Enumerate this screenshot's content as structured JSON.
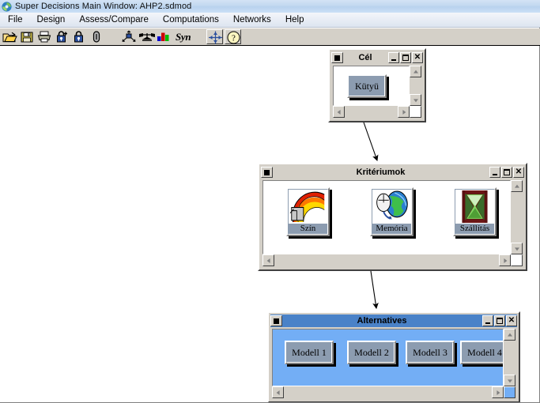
{
  "window": {
    "title": "Super Decisions Main Window: AHP2.sdmod",
    "logo_icon": "refresh-circle-logo"
  },
  "menubar": {
    "items": [
      {
        "label": "File",
        "name": "menu-file"
      },
      {
        "label": "Design",
        "name": "menu-design"
      },
      {
        "label": "Assess/Compare",
        "name": "menu-assess-compare"
      },
      {
        "label": "Computations",
        "name": "menu-computations"
      },
      {
        "label": "Networks",
        "name": "menu-networks"
      },
      {
        "label": "Help",
        "name": "menu-help"
      }
    ]
  },
  "toolbar": {
    "items": [
      {
        "icon": "open-folder-icon",
        "name": "tool-open"
      },
      {
        "icon": "save-disk-icon",
        "name": "tool-save"
      },
      {
        "icon": "printer-icon",
        "name": "tool-print"
      },
      {
        "icon": "lock-plus-icon",
        "name": "tool-add-lock"
      },
      {
        "icon": "lock-icon",
        "name": "tool-lock"
      },
      {
        "icon": "paperclip-icon",
        "name": "tool-attach"
      },
      {
        "icon": "node-cluster-icon",
        "name": "tool-node-cluster"
      },
      {
        "icon": "balance-scale-icon",
        "name": "tool-compare"
      },
      {
        "icon": "bar-chart-icon",
        "name": "tool-results"
      }
    ],
    "syn_label": "Syn",
    "boxed": [
      {
        "icon": "crosshair-icon",
        "name": "tool-crosshair"
      },
      {
        "icon": "question-help-icon",
        "name": "tool-help"
      }
    ]
  },
  "networks": [
    {
      "name": "goal-window",
      "title": "Cél",
      "active": false,
      "buttons": {
        "system": "system-menu",
        "minimize": "–",
        "maximize": "□",
        "close": "✕"
      },
      "nodes": [
        {
          "label": "Kütyü",
          "icon": "none",
          "name": "node-kutyu"
        }
      ]
    },
    {
      "name": "criteria-window",
      "title": "Kritériumok",
      "active": false,
      "buttons": {
        "system": "system-menu",
        "minimize": "–",
        "maximize": "□",
        "close": "✕"
      },
      "nodes": [
        {
          "label": "Szín",
          "icon": "rainbow-paint-icon",
          "name": "node-szin"
        },
        {
          "label": "Memória",
          "icon": "globe-mouse-icon",
          "name": "node-memoria"
        },
        {
          "label": "Szállítás",
          "icon": "hourglass-icon",
          "name": "node-szallitas"
        }
      ]
    },
    {
      "name": "alternatives-window",
      "title": "Alternatives",
      "active": true,
      "buttons": {
        "system": "system-menu",
        "minimize": "–",
        "maximize": "□",
        "close": "✕"
      },
      "nodes": [
        {
          "label": "Modell 1",
          "icon": "none",
          "name": "node-modell-1"
        },
        {
          "label": "Modell 2",
          "icon": "none",
          "name": "node-modell-2"
        },
        {
          "label": "Modell 3",
          "icon": "none",
          "name": "node-modell-3"
        },
        {
          "label": "Modell 4",
          "icon": "none",
          "name": "node-modell-4"
        }
      ]
    }
  ],
  "connections": [
    {
      "name": "arrow-goal-to-criteria",
      "from": "goal-window",
      "to": "criteria-window"
    },
    {
      "name": "arrow-criteria-to-alternatives",
      "from": "criteria-window",
      "to": "alternatives-window"
    }
  ],
  "colors": {
    "active_titlebar": "#4a82c8",
    "active_client": "#73aef5",
    "window_face": "#d4d0c8",
    "node_face": "#8c9cb0",
    "canvas": "#ffffff"
  }
}
